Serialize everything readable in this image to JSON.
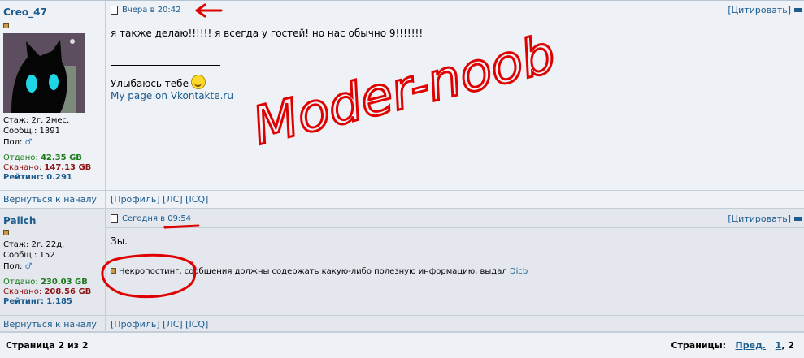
{
  "posts": [
    {
      "author": "Creo_47",
      "stats": {
        "stazh": "Стаж: 2г. 2мес.",
        "soobsh": "Сообщ.: 1391",
        "pol": "Пол:",
        "otdano_label": "Отдано:",
        "otdano": "42.35 GB",
        "skachano_label": "Скачано:",
        "skachano": "147.13 GB",
        "rating_label": "Рейтинг:",
        "rating": "0.291"
      },
      "date": "Вчера в 20:42",
      "quote": "[Цитировать]",
      "message": "я также делаю!!!!!! я всегда у гостей! но нас обычно 9!!!!!!!",
      "signature_text": "Улыбаюсь тебе",
      "signature_link": "My page on Vkontakte.ru",
      "back": "Вернуться к началу",
      "actions": "[Профиль]  [ЛС]  [ICQ]"
    },
    {
      "author": "Palich",
      "stats": {
        "stazh": "Стаж: 2г. 22д.",
        "soobsh": "Сообщ.: 152",
        "pol": "Пол:",
        "otdano_label": "Отдано:",
        "otdano": "230.03 GB",
        "skachano_label": "Скачано:",
        "skachano": "208.56 GB",
        "rating_label": "Рейтинг:",
        "rating": "1.185"
      },
      "date": "Сегодня в 09:54",
      "quote": "[Цитировать]",
      "message": "Зы.",
      "mod_note": "Некропостинг, сообщения должны содержать какую-либо полезную информацию, выдал",
      "mod_name": "Dicb",
      "back": "Вернуться к началу",
      "actions": "[Профиль]  [ЛС]  [ICQ]"
    }
  ],
  "pagination": {
    "info": "Страница 2 из 2",
    "label": "Страницы:",
    "prev": "Пред.",
    "p1": "1",
    "sep": ",",
    "p2": "2"
  },
  "annotation": {
    "text": "Moder-noob"
  },
  "colors": {
    "link": "#1c5c8e",
    "ink": "#e00000"
  }
}
